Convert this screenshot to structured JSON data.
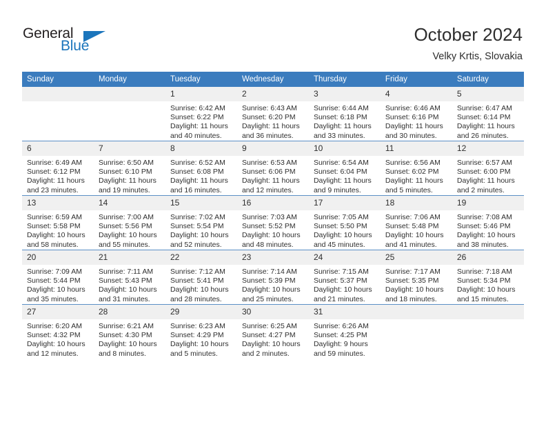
{
  "logo": {
    "word_one": "General",
    "word_two": "Blue",
    "triangle_icon": "triangle-right-icon",
    "color_primary": "#1b75bc",
    "color_text": "#231f20"
  },
  "header": {
    "title": "October 2024",
    "subtitle": "Velky Krtis, Slovakia"
  },
  "theme": {
    "header_background": "#3b7cbe",
    "header_text": "#ffffff",
    "daynum_background": "#f0f0f0",
    "row_divider": "#5b8fc6",
    "body_text": "#2e2e2e"
  },
  "weekdays": [
    "Sunday",
    "Monday",
    "Tuesday",
    "Wednesday",
    "Thursday",
    "Friday",
    "Saturday"
  ],
  "labels": {
    "sunrise_prefix": "Sunrise:",
    "sunset_prefix": "Sunset:",
    "daylight_prefix": "Daylight:"
  },
  "weeks": [
    [
      {
        "day": "",
        "empty": true,
        "line1": "",
        "line2": "",
        "line3": "",
        "line4": ""
      },
      {
        "day": "",
        "empty": true,
        "line1": "",
        "line2": "",
        "line3": "",
        "line4": ""
      },
      {
        "day": "1",
        "line1": "Sunrise: 6:42 AM",
        "line2": "Sunset: 6:22 PM",
        "line3": "Daylight: 11 hours",
        "line4": "and 40 minutes."
      },
      {
        "day": "2",
        "line1": "Sunrise: 6:43 AM",
        "line2": "Sunset: 6:20 PM",
        "line3": "Daylight: 11 hours",
        "line4": "and 36 minutes."
      },
      {
        "day": "3",
        "line1": "Sunrise: 6:44 AM",
        "line2": "Sunset: 6:18 PM",
        "line3": "Daylight: 11 hours",
        "line4": "and 33 minutes."
      },
      {
        "day": "4",
        "line1": "Sunrise: 6:46 AM",
        "line2": "Sunset: 6:16 PM",
        "line3": "Daylight: 11 hours",
        "line4": "and 30 minutes."
      },
      {
        "day": "5",
        "line1": "Sunrise: 6:47 AM",
        "line2": "Sunset: 6:14 PM",
        "line3": "Daylight: 11 hours",
        "line4": "and 26 minutes."
      }
    ],
    [
      {
        "day": "6",
        "line1": "Sunrise: 6:49 AM",
        "line2": "Sunset: 6:12 PM",
        "line3": "Daylight: 11 hours",
        "line4": "and 23 minutes."
      },
      {
        "day": "7",
        "line1": "Sunrise: 6:50 AM",
        "line2": "Sunset: 6:10 PM",
        "line3": "Daylight: 11 hours",
        "line4": "and 19 minutes."
      },
      {
        "day": "8",
        "line1": "Sunrise: 6:52 AM",
        "line2": "Sunset: 6:08 PM",
        "line3": "Daylight: 11 hours",
        "line4": "and 16 minutes."
      },
      {
        "day": "9",
        "line1": "Sunrise: 6:53 AM",
        "line2": "Sunset: 6:06 PM",
        "line3": "Daylight: 11 hours",
        "line4": "and 12 minutes."
      },
      {
        "day": "10",
        "line1": "Sunrise: 6:54 AM",
        "line2": "Sunset: 6:04 PM",
        "line3": "Daylight: 11 hours",
        "line4": "and 9 minutes."
      },
      {
        "day": "11",
        "line1": "Sunrise: 6:56 AM",
        "line2": "Sunset: 6:02 PM",
        "line3": "Daylight: 11 hours",
        "line4": "and 5 minutes."
      },
      {
        "day": "12",
        "line1": "Sunrise: 6:57 AM",
        "line2": "Sunset: 6:00 PM",
        "line3": "Daylight: 11 hours",
        "line4": "and 2 minutes."
      }
    ],
    [
      {
        "day": "13",
        "line1": "Sunrise: 6:59 AM",
        "line2": "Sunset: 5:58 PM",
        "line3": "Daylight: 10 hours",
        "line4": "and 58 minutes."
      },
      {
        "day": "14",
        "line1": "Sunrise: 7:00 AM",
        "line2": "Sunset: 5:56 PM",
        "line3": "Daylight: 10 hours",
        "line4": "and 55 minutes."
      },
      {
        "day": "15",
        "line1": "Sunrise: 7:02 AM",
        "line2": "Sunset: 5:54 PM",
        "line3": "Daylight: 10 hours",
        "line4": "and 52 minutes."
      },
      {
        "day": "16",
        "line1": "Sunrise: 7:03 AM",
        "line2": "Sunset: 5:52 PM",
        "line3": "Daylight: 10 hours",
        "line4": "and 48 minutes."
      },
      {
        "day": "17",
        "line1": "Sunrise: 7:05 AM",
        "line2": "Sunset: 5:50 PM",
        "line3": "Daylight: 10 hours",
        "line4": "and 45 minutes."
      },
      {
        "day": "18",
        "line1": "Sunrise: 7:06 AM",
        "line2": "Sunset: 5:48 PM",
        "line3": "Daylight: 10 hours",
        "line4": "and 41 minutes."
      },
      {
        "day": "19",
        "line1": "Sunrise: 7:08 AM",
        "line2": "Sunset: 5:46 PM",
        "line3": "Daylight: 10 hours",
        "line4": "and 38 minutes."
      }
    ],
    [
      {
        "day": "20",
        "line1": "Sunrise: 7:09 AM",
        "line2": "Sunset: 5:44 PM",
        "line3": "Daylight: 10 hours",
        "line4": "and 35 minutes."
      },
      {
        "day": "21",
        "line1": "Sunrise: 7:11 AM",
        "line2": "Sunset: 5:43 PM",
        "line3": "Daylight: 10 hours",
        "line4": "and 31 minutes."
      },
      {
        "day": "22",
        "line1": "Sunrise: 7:12 AM",
        "line2": "Sunset: 5:41 PM",
        "line3": "Daylight: 10 hours",
        "line4": "and 28 minutes."
      },
      {
        "day": "23",
        "line1": "Sunrise: 7:14 AM",
        "line2": "Sunset: 5:39 PM",
        "line3": "Daylight: 10 hours",
        "line4": "and 25 minutes."
      },
      {
        "day": "24",
        "line1": "Sunrise: 7:15 AM",
        "line2": "Sunset: 5:37 PM",
        "line3": "Daylight: 10 hours",
        "line4": "and 21 minutes."
      },
      {
        "day": "25",
        "line1": "Sunrise: 7:17 AM",
        "line2": "Sunset: 5:35 PM",
        "line3": "Daylight: 10 hours",
        "line4": "and 18 minutes."
      },
      {
        "day": "26",
        "line1": "Sunrise: 7:18 AM",
        "line2": "Sunset: 5:34 PM",
        "line3": "Daylight: 10 hours",
        "line4": "and 15 minutes."
      }
    ],
    [
      {
        "day": "27",
        "line1": "Sunrise: 6:20 AM",
        "line2": "Sunset: 4:32 PM",
        "line3": "Daylight: 10 hours",
        "line4": "and 12 minutes."
      },
      {
        "day": "28",
        "line1": "Sunrise: 6:21 AM",
        "line2": "Sunset: 4:30 PM",
        "line3": "Daylight: 10 hours",
        "line4": "and 8 minutes."
      },
      {
        "day": "29",
        "line1": "Sunrise: 6:23 AM",
        "line2": "Sunset: 4:29 PM",
        "line3": "Daylight: 10 hours",
        "line4": "and 5 minutes."
      },
      {
        "day": "30",
        "line1": "Sunrise: 6:25 AM",
        "line2": "Sunset: 4:27 PM",
        "line3": "Daylight: 10 hours",
        "line4": "and 2 minutes."
      },
      {
        "day": "31",
        "line1": "Sunrise: 6:26 AM",
        "line2": "Sunset: 4:25 PM",
        "line3": "Daylight: 9 hours",
        "line4": "and 59 minutes."
      },
      {
        "day": "",
        "empty": true,
        "line1": "",
        "line2": "",
        "line3": "",
        "line4": ""
      },
      {
        "day": "",
        "empty": true,
        "line1": "",
        "line2": "",
        "line3": "",
        "line4": ""
      }
    ]
  ]
}
